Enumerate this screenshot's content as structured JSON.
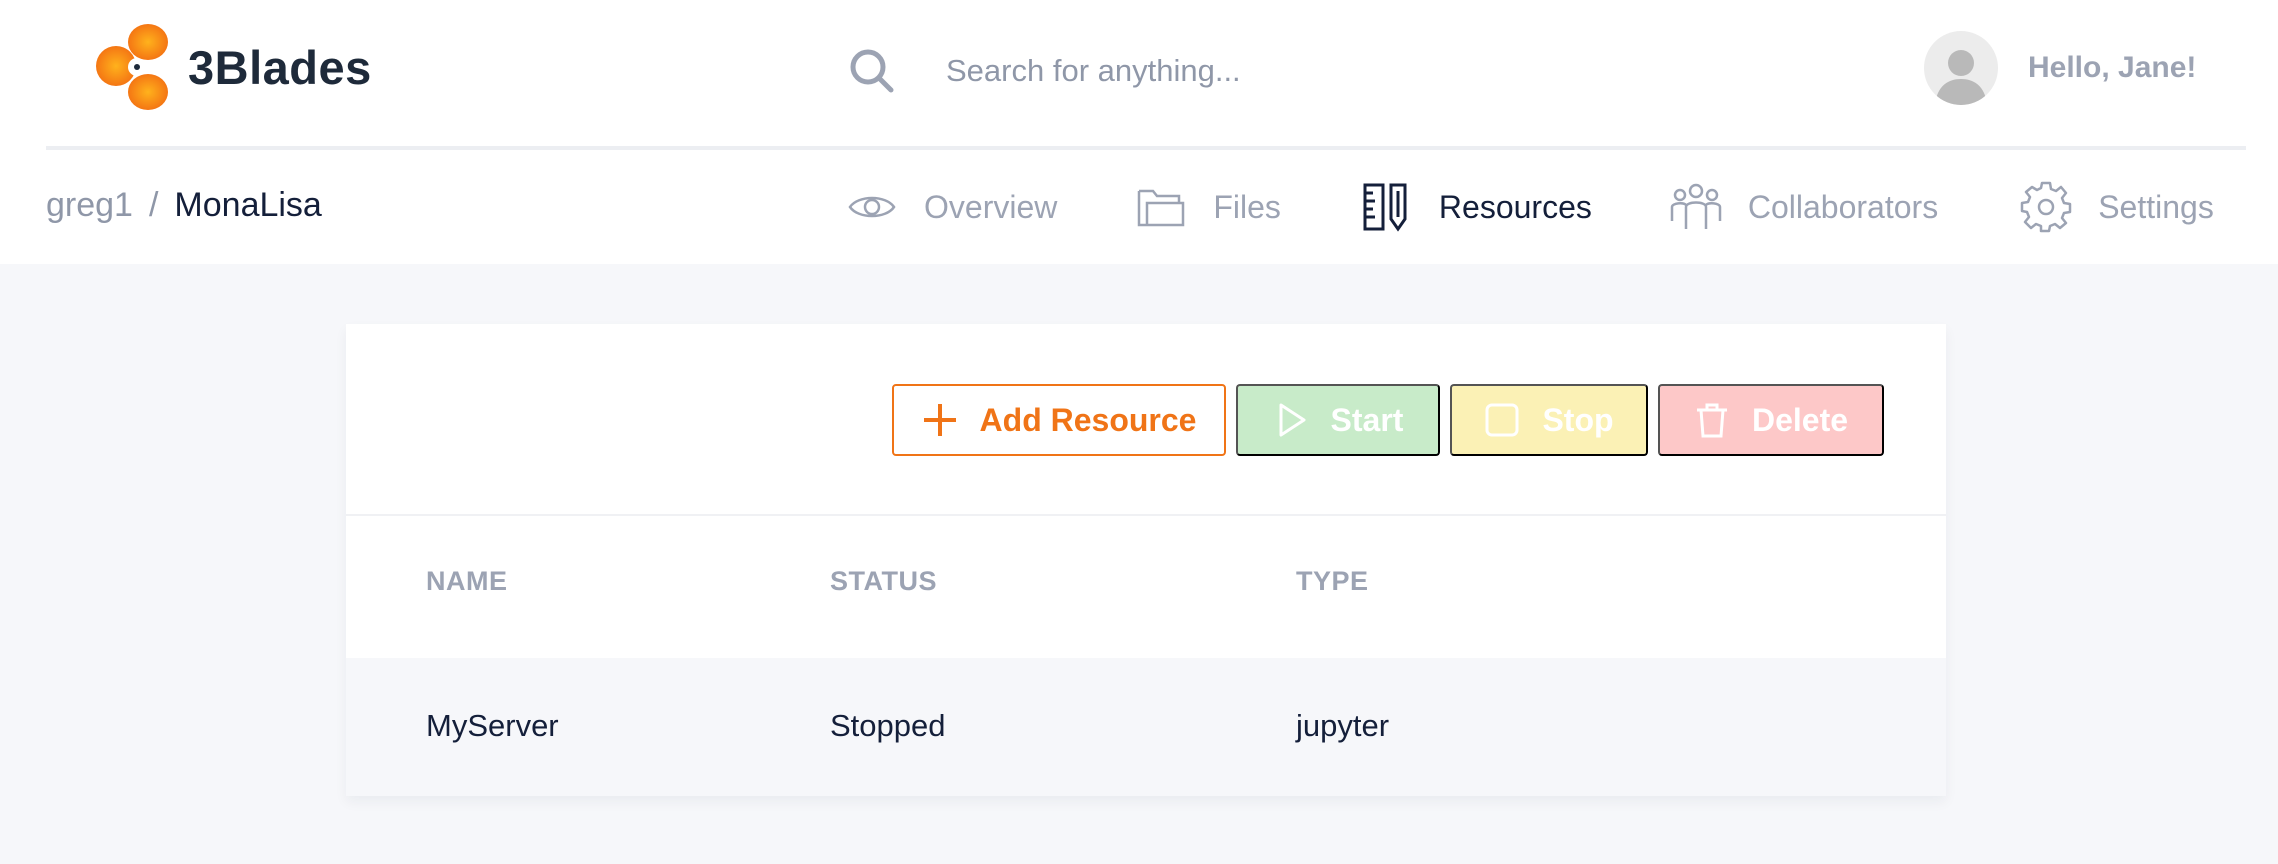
{
  "brand": {
    "name": "3Blades",
    "accent": "#f07417"
  },
  "search": {
    "placeholder": "Search for anything...",
    "value": ""
  },
  "user": {
    "greeting": "Hello, Jane!"
  },
  "breadcrumb": {
    "owner": "greg1",
    "separator": "/",
    "project": "MonaLisa"
  },
  "tabs": [
    {
      "label": "Overview",
      "icon": "eye-icon",
      "active": false
    },
    {
      "label": "Files",
      "icon": "folder-icon",
      "active": false
    },
    {
      "label": "Resources",
      "icon": "ruler-pencil-icon",
      "active": true
    },
    {
      "label": "Collaborators",
      "icon": "people-icon",
      "active": false
    },
    {
      "label": "Settings",
      "icon": "gear-icon",
      "active": false
    }
  ],
  "toolbar": {
    "add_label": "Add Resource",
    "start_label": "Start",
    "stop_label": "Stop",
    "delete_label": "Delete"
  },
  "table": {
    "columns": [
      "NAME",
      "STATUS",
      "TYPE"
    ],
    "rows": [
      {
        "name": "MyServer",
        "status": "Stopped",
        "type": "jupyter"
      }
    ]
  },
  "colors": {
    "text_dark": "#141f3a",
    "text_muted": "#9ca3b3",
    "start_bg": "#c8ebc9",
    "stop_bg": "#fbf1b5",
    "delete_bg": "#fdc8c8"
  }
}
